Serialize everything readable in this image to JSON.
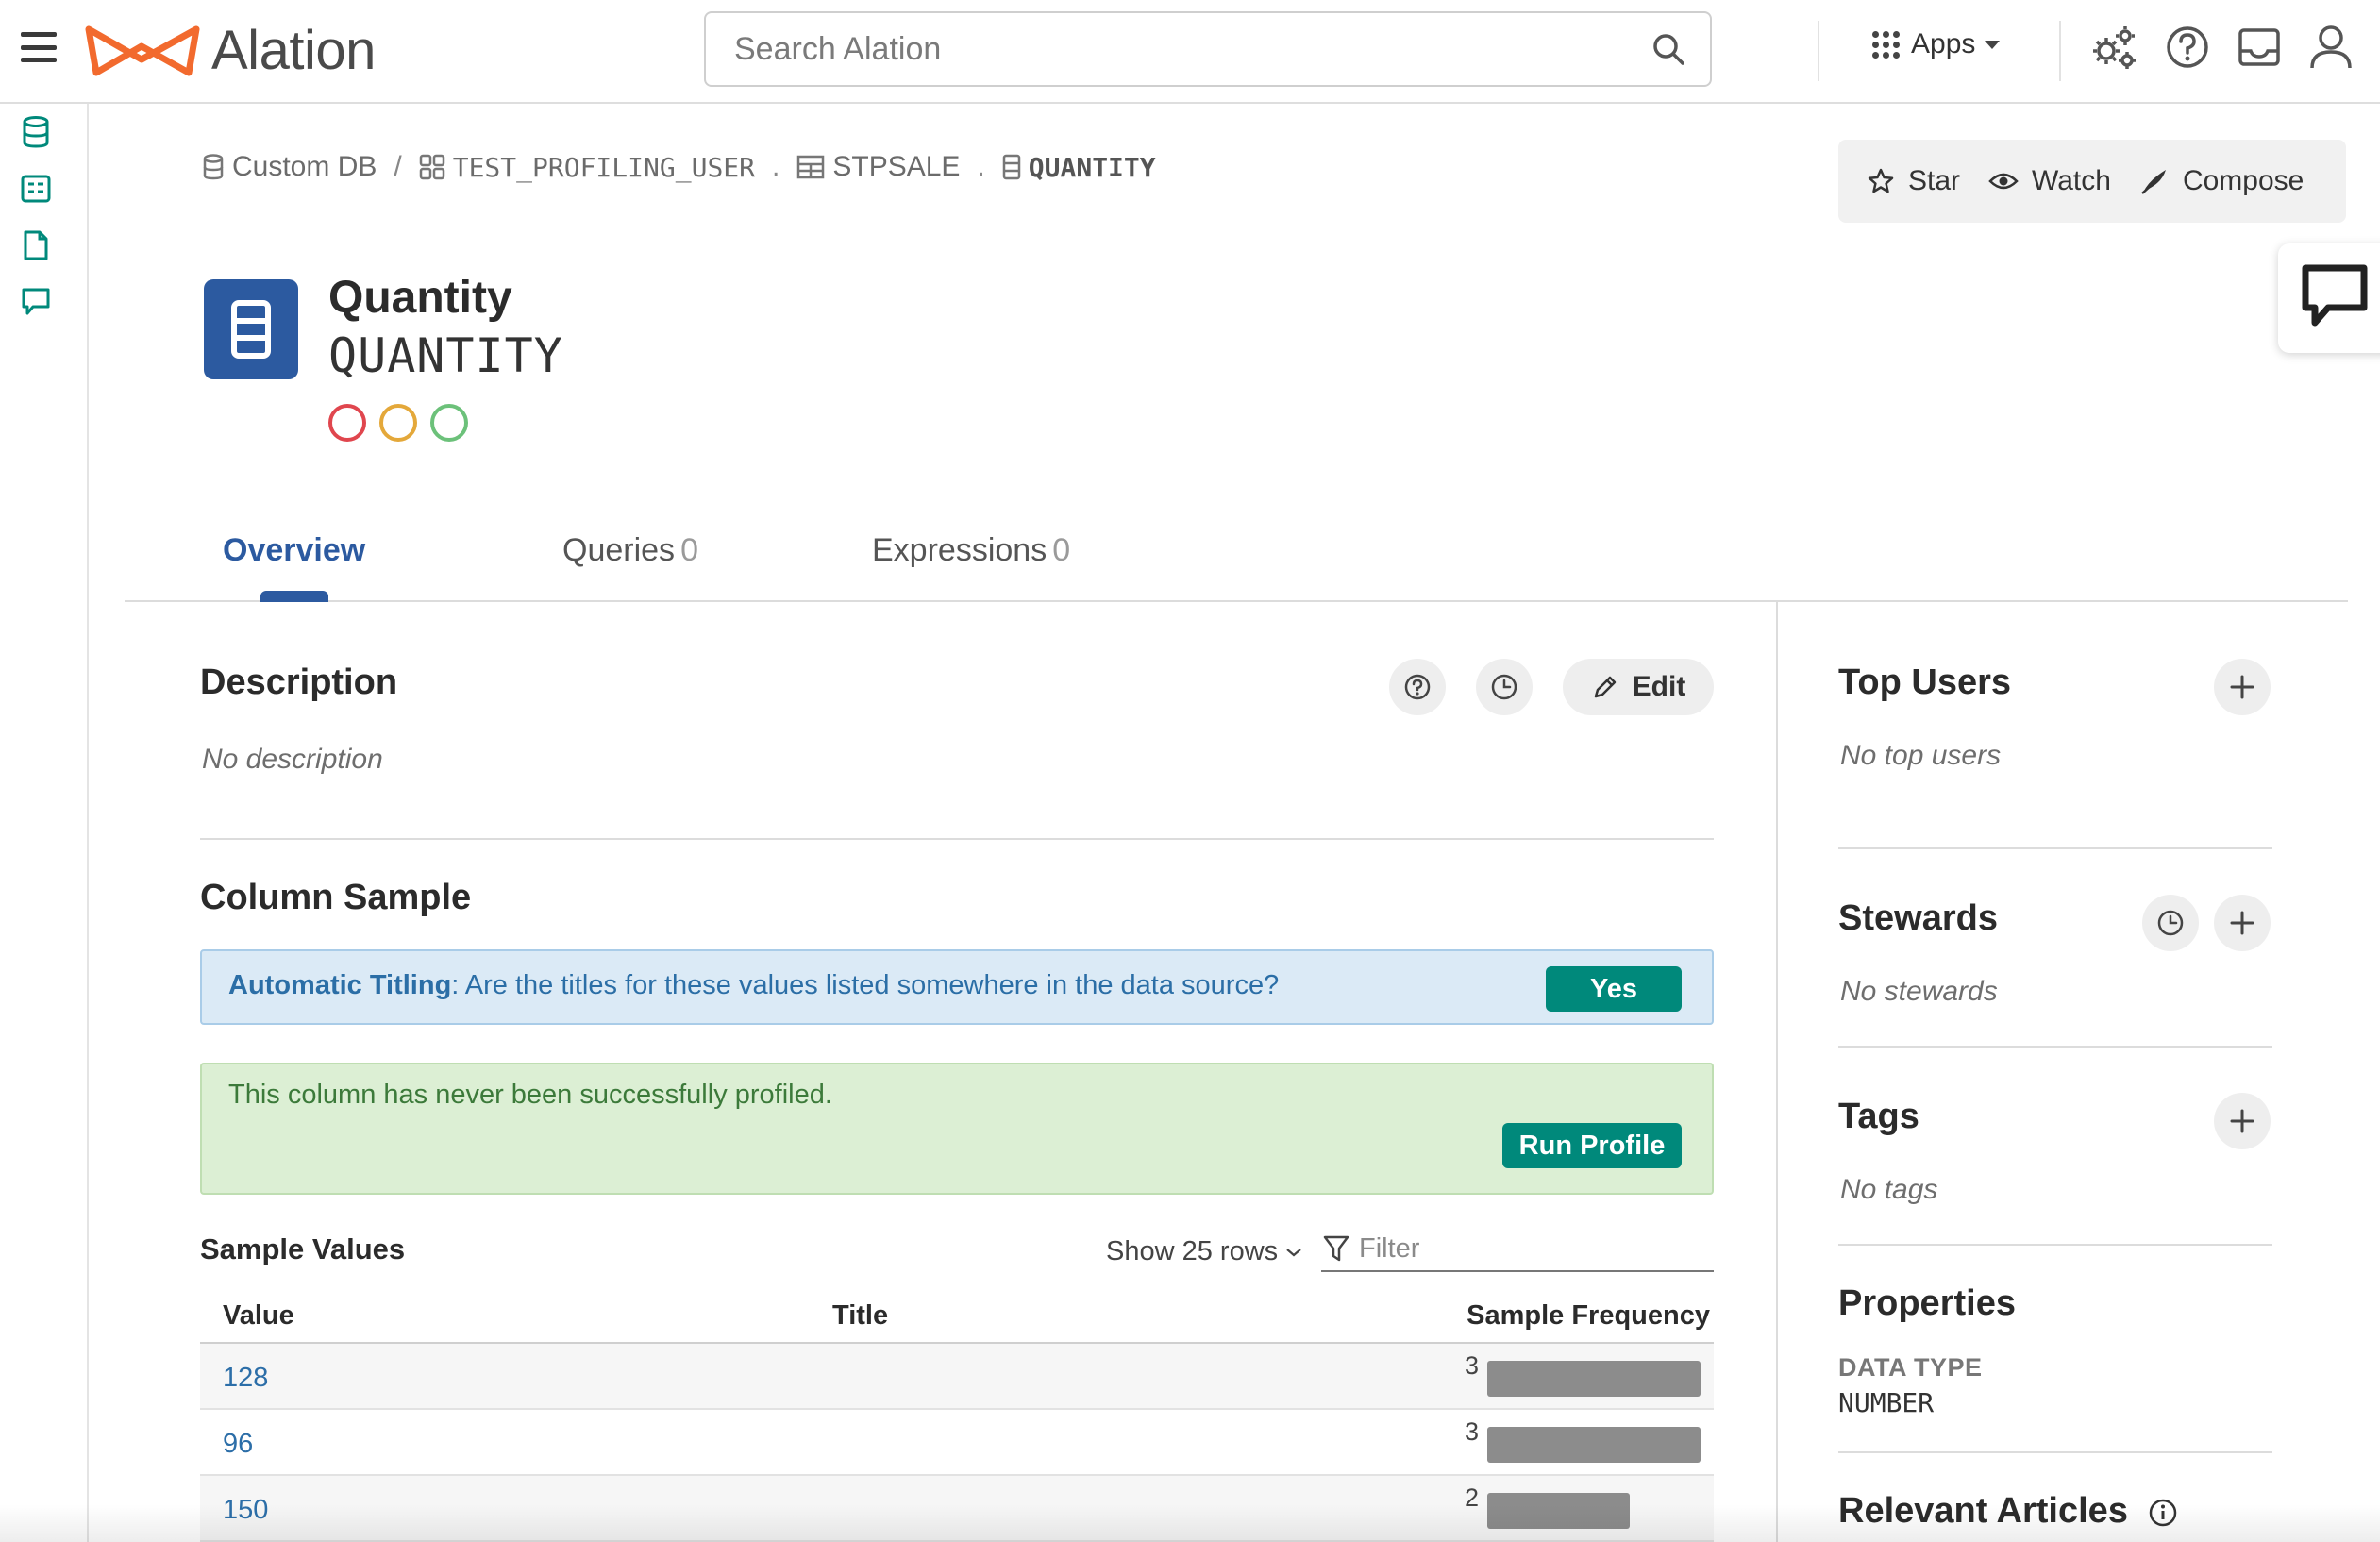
{
  "colors": {
    "brand_orange": "#f26a2e",
    "accent_blue": "#2c5aa0",
    "teal": "#00897b",
    "link_blue": "#2c6ea8",
    "trust_red": "#e0464e",
    "trust_yellow": "#e4a83a",
    "trust_green": "#6cc17a"
  },
  "topbar": {
    "brand": "Alation",
    "search_placeholder": "Search Alation",
    "apps_label": "Apps",
    "icons": [
      "menu-icon",
      "search-icon",
      "apps-grid-icon",
      "settings-gears-icon",
      "help-icon",
      "inbox-icon",
      "user-icon"
    ]
  },
  "leftrail": {
    "icons": [
      "database-icon",
      "catalog-icon",
      "document-icon",
      "conversation-icon"
    ]
  },
  "breadcrumb": [
    {
      "label": "Custom DB",
      "icon": "database-icon"
    },
    {
      "label": "TEST_PROFILING_USER",
      "icon": "schema-icon"
    },
    {
      "label": "STPSALE",
      "icon": "table-icon"
    },
    {
      "label": "QUANTITY",
      "icon": "column-icon"
    }
  ],
  "breadcrumb_separators": [
    "/",
    ".",
    "."
  ],
  "actions": {
    "star": "Star",
    "watch": "Watch",
    "compose": "Compose"
  },
  "object": {
    "title": "Quantity",
    "subtitle": "QUANTITY",
    "icon": "column-icon",
    "trust_flags": [
      "deprecation-flag",
      "warning-flag",
      "endorsement-flag"
    ]
  },
  "tabs": [
    {
      "label": "Overview",
      "count": ""
    },
    {
      "label": "Queries",
      "count": "0"
    },
    {
      "label": "Expressions",
      "count": "0"
    }
  ],
  "description": {
    "title": "Description",
    "empty": "No description",
    "edit_label": "Edit"
  },
  "column_sample": {
    "title": "Column Sample",
    "titling_label": "Automatic Titling",
    "titling_question": ": Are the titles for these values listed somewhere in the data source?",
    "yes_label": "Yes",
    "profile_message": "This column has never been successfully profiled.",
    "run_profile_label": "Run Profile"
  },
  "sample_values": {
    "title": "Sample Values",
    "show_rows": "Show 25 rows",
    "filter_placeholder": "Filter",
    "columns": [
      "Value",
      "Title",
      "Sample Frequency"
    ],
    "rows": [
      {
        "value": "128",
        "title": "",
        "frequency": "3",
        "bar_fraction": 1.0
      },
      {
        "value": "96",
        "title": "",
        "frequency": "3",
        "bar_fraction": 1.0
      },
      {
        "value": "150",
        "title": "",
        "frequency": "2",
        "bar_fraction": 0.667
      }
    ]
  },
  "right_panel": {
    "top_users": {
      "title": "Top Users",
      "empty": "No top users"
    },
    "stewards": {
      "title": "Stewards",
      "empty": "No stewards"
    },
    "tags": {
      "title": "Tags",
      "empty": "No tags"
    },
    "properties": {
      "title": "Properties",
      "label": "DATA TYPE",
      "value": "NUMBER"
    },
    "relevant_articles": {
      "title": "Relevant Articles"
    }
  }
}
